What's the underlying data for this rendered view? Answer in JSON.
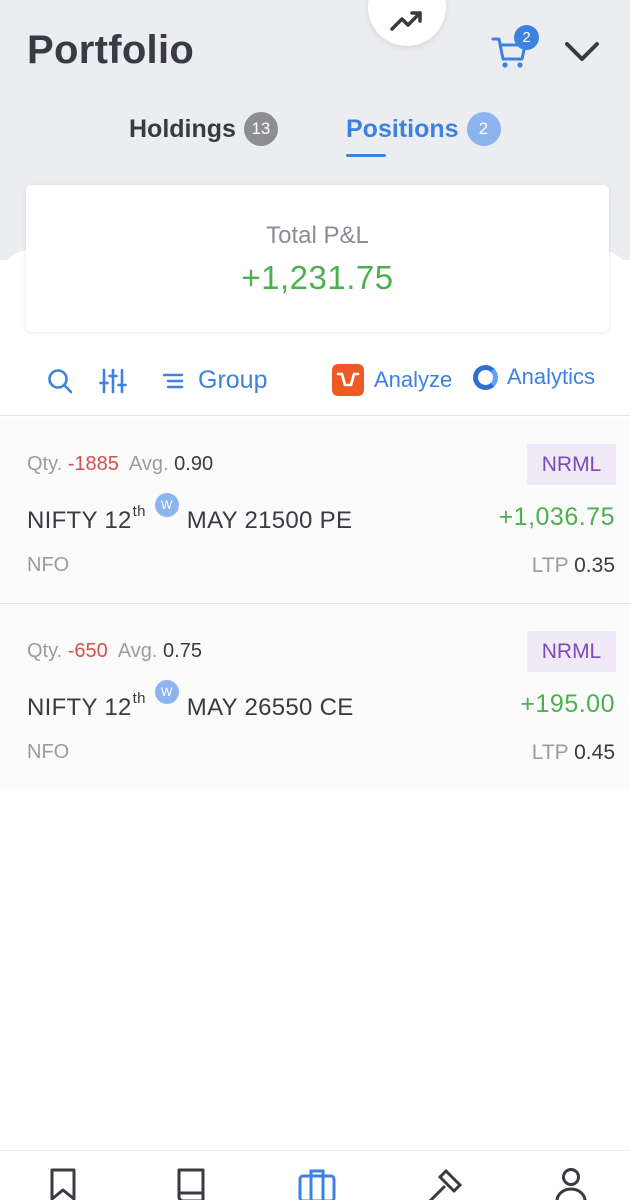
{
  "header": {
    "title": "Portfolio",
    "cart_count": "2"
  },
  "tabs": [
    {
      "label": "Holdings",
      "count": "13"
    },
    {
      "label": "Positions",
      "count": "2"
    }
  ],
  "summary": {
    "label": "Total P&L",
    "value": "+1,231.75"
  },
  "toolbar": {
    "group_label": "Group",
    "analyze_label": "Analyze",
    "analytics_label": "Analytics"
  },
  "positions": [
    {
      "qty_label": "Qty.",
      "qty": "-1885",
      "avg_label": "Avg.",
      "avg": "0.90",
      "product": "NRML",
      "symbol": "NIFTY 12",
      "symbol_sup": "th",
      "weekly_badge": "W",
      "contract": "MAY 21500 PE",
      "exchange": "NFO",
      "pnl": "+1,036.75",
      "ltp_label": "LTP",
      "ltp": "0.35"
    },
    {
      "qty_label": "Qty.",
      "qty": "-650",
      "avg_label": "Avg.",
      "avg": "0.75",
      "product": "NRML",
      "symbol": "NIFTY 12",
      "symbol_sup": "th",
      "weekly_badge": "W",
      "contract": "MAY 26550 CE",
      "exchange": "NFO",
      "pnl": "+195.00",
      "ltp_label": "LTP",
      "ltp": "0.45"
    }
  ],
  "bottom_nav": [
    {
      "name": "watchlist",
      "icon": "bookmark-icon"
    },
    {
      "name": "orders",
      "icon": "book-icon"
    },
    {
      "name": "portfolio",
      "icon": "briefcase-icon"
    },
    {
      "name": "bids",
      "icon": "gavel-icon"
    },
    {
      "name": "account",
      "icon": "user-icon"
    }
  ],
  "colors": {
    "accent": "#3d82e0",
    "profit": "#4caf50",
    "loss": "#d4504f",
    "product_tag_bg": "#f0eaf8",
    "product_tag_text": "#7b4bb8"
  }
}
